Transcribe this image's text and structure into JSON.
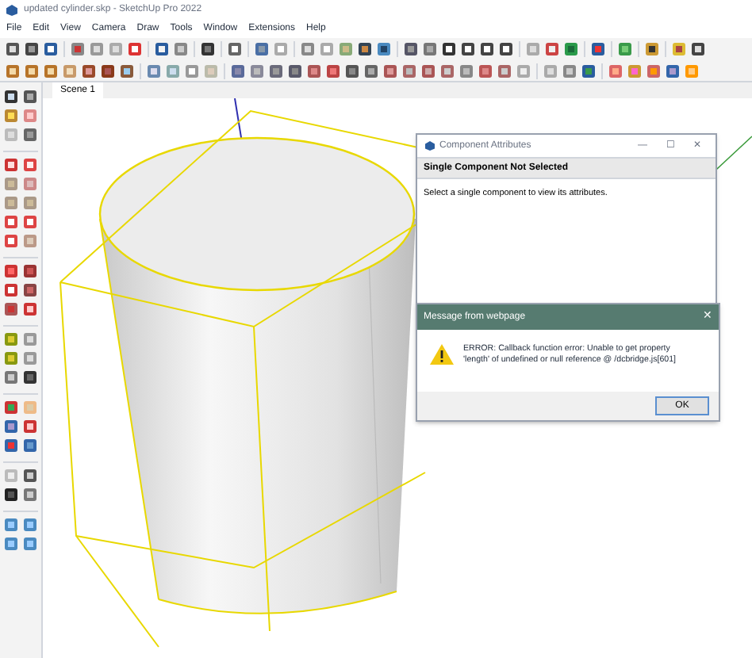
{
  "window": {
    "title": "updated cylinder.skp - SketchUp Pro 2022"
  },
  "menu": [
    "File",
    "Edit",
    "View",
    "Camera",
    "Draw",
    "Tools",
    "Window",
    "Extensions",
    "Help"
  ],
  "scene_tabs": [
    {
      "label": "Scene 1",
      "selected": true
    }
  ],
  "component_attributes": {
    "title": "Component Attributes",
    "controls": [
      "—",
      "☐",
      "✕"
    ],
    "heading": "Single Component Not Selected",
    "body": "Select a single component to view its attributes."
  },
  "message": {
    "title": "Message from webpage",
    "close": "✕",
    "text_lines": [
      "ERROR: Callback function error: Unable to get property",
      "'length' of undefined or null reference @ /dcbridge.js[601]"
    ],
    "button": "OK"
  }
}
